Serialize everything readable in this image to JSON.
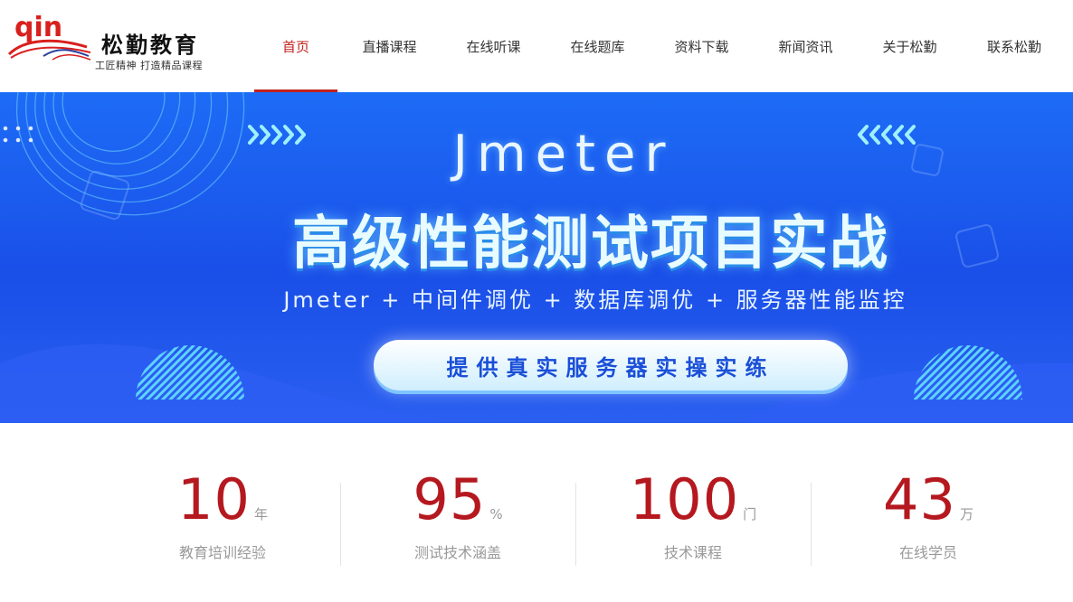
{
  "brand": {
    "mark_text": "qin",
    "name": "松勤教育",
    "slogan": "工匠精神 打造精品课程"
  },
  "nav": {
    "items": [
      {
        "label": "首页",
        "active": true
      },
      {
        "label": "直播课程"
      },
      {
        "label": "在线听课"
      },
      {
        "label": "在线题库"
      },
      {
        "label": "资料下载"
      },
      {
        "label": "新闻资讯"
      },
      {
        "label": "关于松勤"
      },
      {
        "label": "联系松勤"
      }
    ]
  },
  "banner": {
    "title_en": "Jmeter",
    "title_cn": "高级性能测试项目实战",
    "subtitle": "Jmeter + 中间件调优 + 数据库调优 + 服务器性能监控",
    "pill": "提供真实服务器实操实练"
  },
  "stats": [
    {
      "value": "10",
      "unit": "年",
      "label": "教育培训经验"
    },
    {
      "value": "95",
      "unit": "%",
      "label": "测试技术涵盖"
    },
    {
      "value": "100",
      "unit": "门",
      "label": "技术课程"
    },
    {
      "value": "43",
      "unit": "万",
      "label": "在线学员"
    }
  ],
  "colors": {
    "accent": "#c0221e",
    "banner": "#1a4fe8",
    "stat_number": "#b5181f"
  }
}
